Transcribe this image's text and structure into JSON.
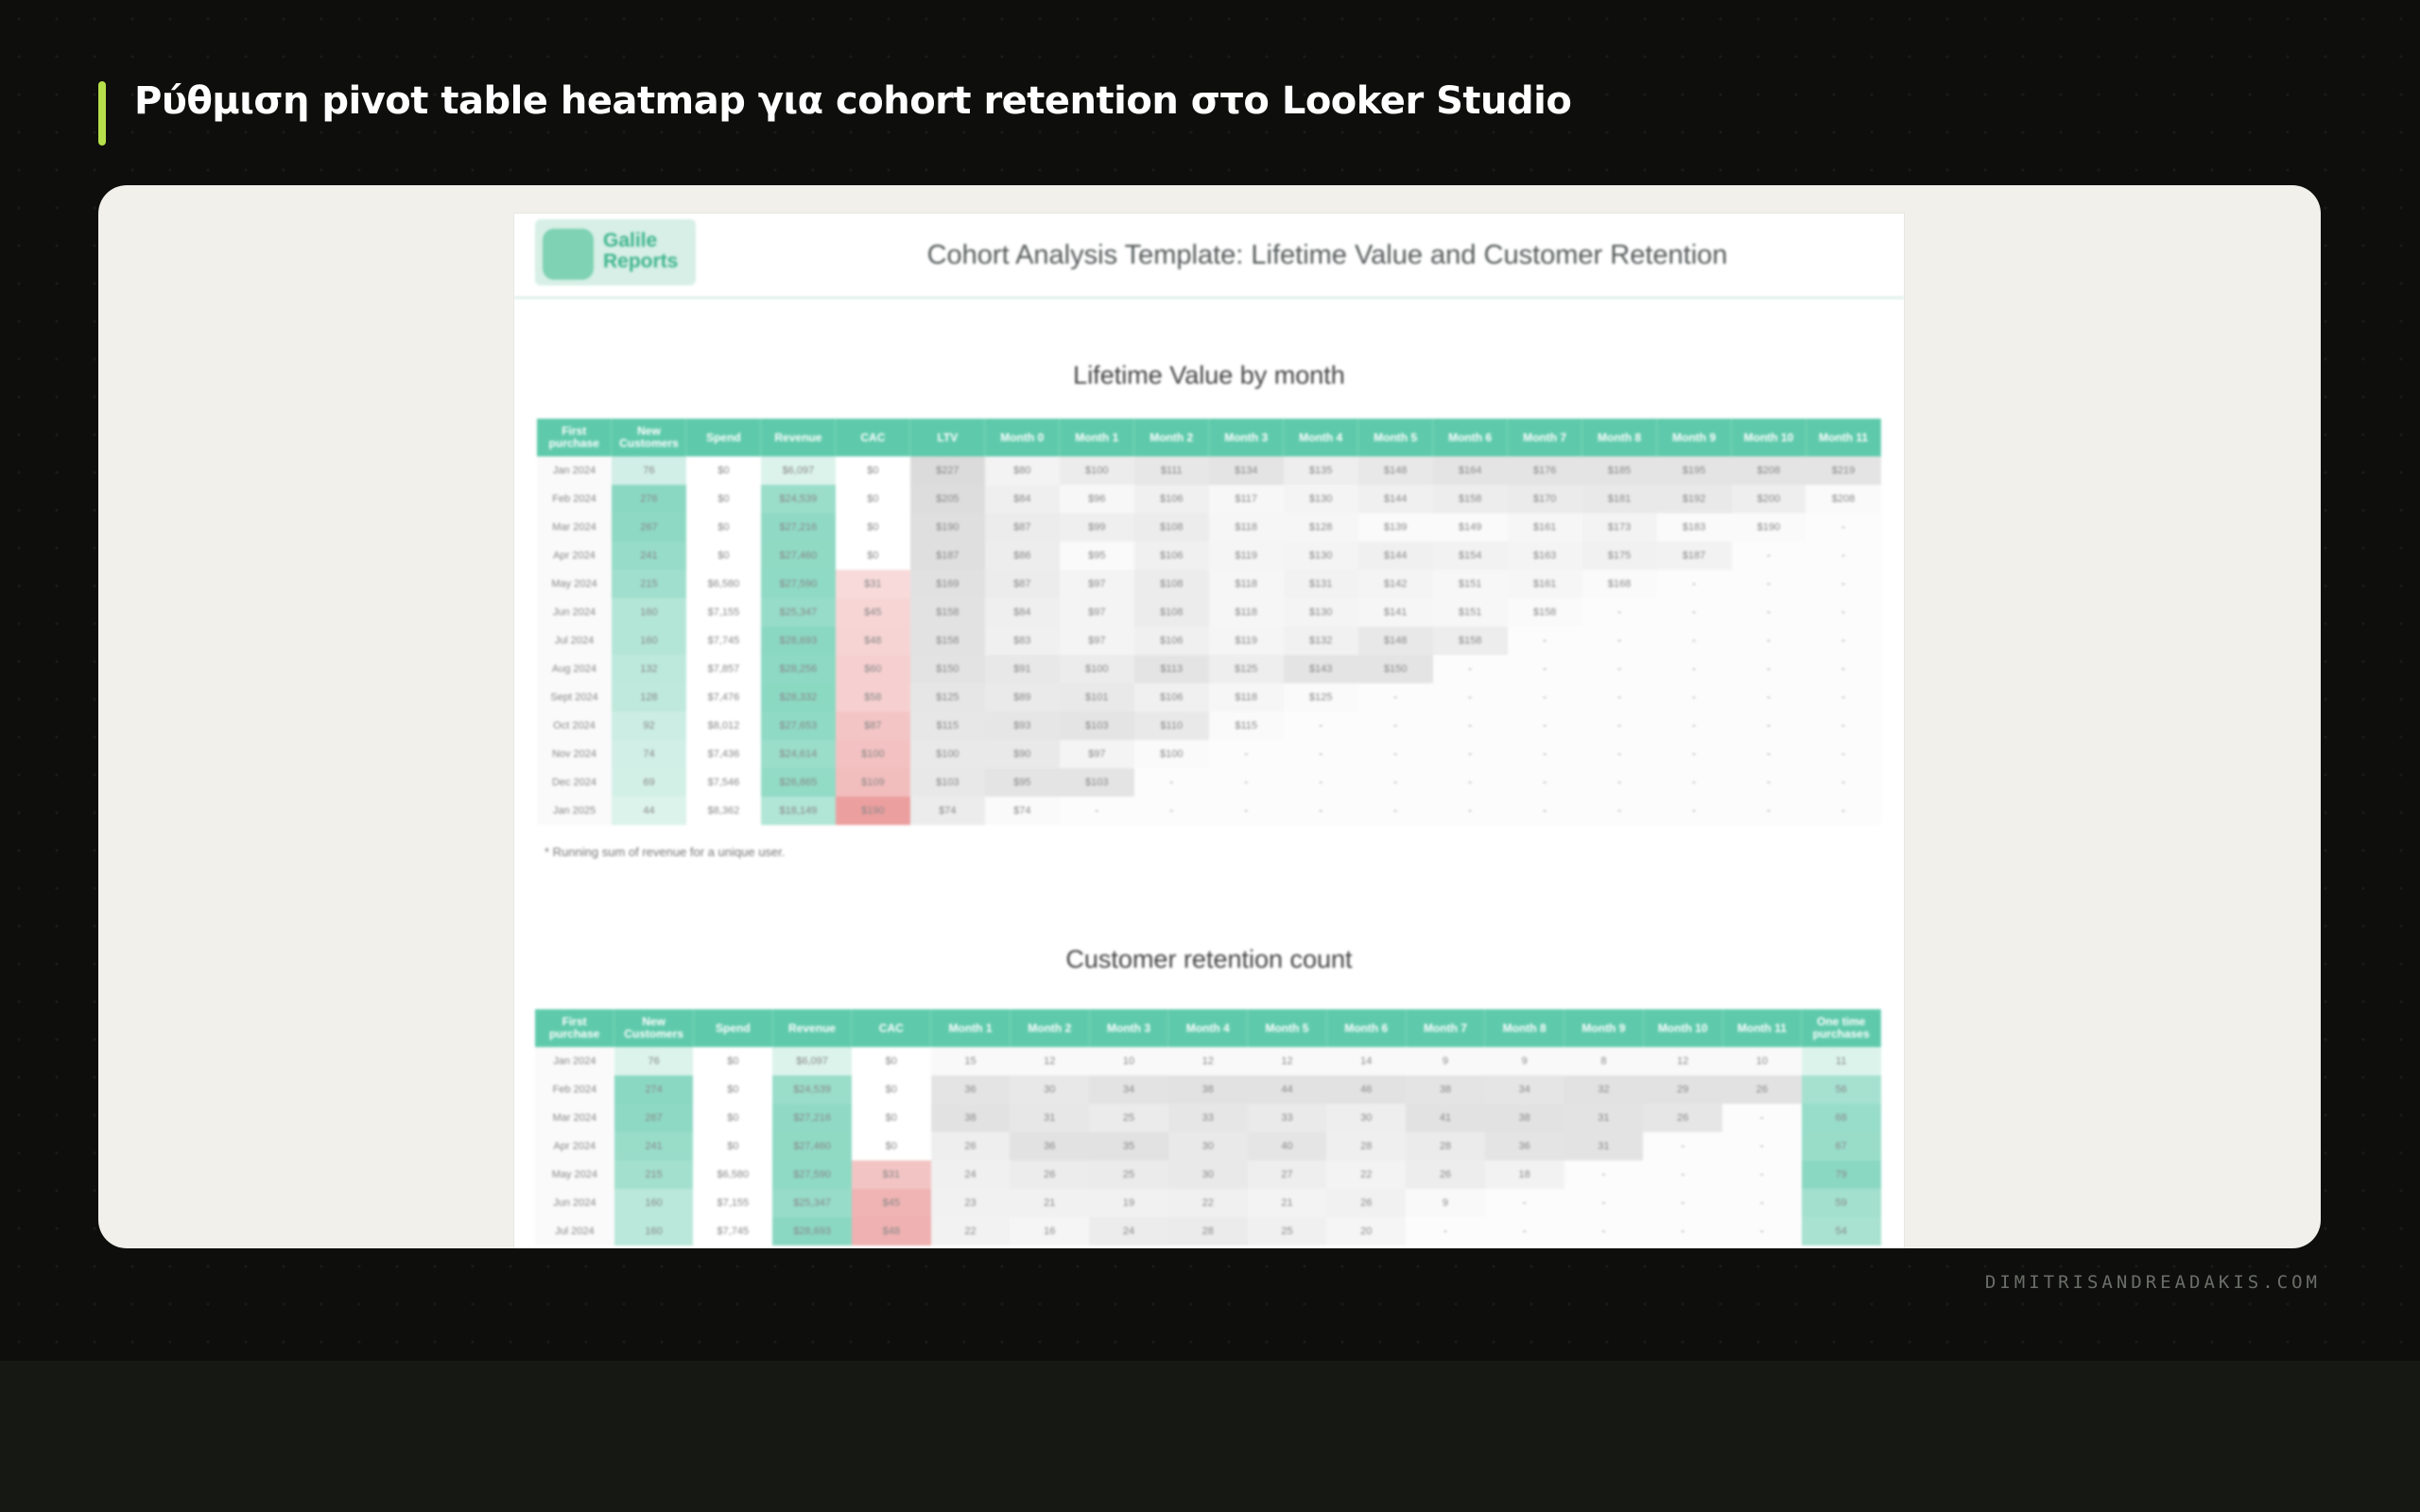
{
  "page": {
    "title": "Ρύθμιση pivot table heatmap για cohort retention στο Looker Studio",
    "credit": "DIMITRISANDREADAKIS.COM",
    "accent_color": "#b6e04a"
  },
  "document": {
    "logo_text": "Galile Reports",
    "title": "Cohort Analysis Template: Lifetime Value and Customer Retention",
    "brand_color": "#5fcaab"
  },
  "ltv_table": {
    "title": "Lifetime Value by month",
    "footnote": "* Running sum of revenue for a unique user.",
    "columns": [
      "First purchase",
      "New Customers",
      "Spend",
      "Revenue",
      "CAC",
      "LTV",
      "Month 0",
      "Month 1",
      "Month 2",
      "Month 3",
      "Month 4",
      "Month 5",
      "Month 6",
      "Month 7",
      "Month 8",
      "Month 9",
      "Month 10",
      "Month 11"
    ],
    "rows": [
      [
        "Jan 2024",
        "76",
        "$0",
        "$6,097",
        "$0",
        "$227",
        "$80",
        "$100",
        "$111",
        "$134",
        "$135",
        "$148",
        "$164",
        "$176",
        "$185",
        "$195",
        "$208",
        "$219"
      ],
      [
        "Feb 2024",
        "276",
        "$0",
        "$24,539",
        "$0",
        "$205",
        "$84",
        "$96",
        "$106",
        "$117",
        "$130",
        "$144",
        "$158",
        "$170",
        "$181",
        "$192",
        "$200",
        "$208"
      ],
      [
        "Mar 2024",
        "267",
        "$0",
        "$27,216",
        "$0",
        "$190",
        "$87",
        "$99",
        "$108",
        "$118",
        "$128",
        "$139",
        "$149",
        "$161",
        "$173",
        "$183",
        "$190",
        "-"
      ],
      [
        "Apr 2024",
        "241",
        "$0",
        "$27,460",
        "$0",
        "$187",
        "$86",
        "$95",
        "$106",
        "$119",
        "$130",
        "$144",
        "$154",
        "$163",
        "$175",
        "$187",
        "-",
        "-"
      ],
      [
        "May 2024",
        "215",
        "$6,580",
        "$27,590",
        "$31",
        "$169",
        "$87",
        "$97",
        "$108",
        "$118",
        "$131",
        "$142",
        "$151",
        "$161",
        "$168",
        "-",
        "-",
        "-"
      ],
      [
        "Jun 2024",
        "160",
        "$7,155",
        "$25,347",
        "$45",
        "$158",
        "$84",
        "$97",
        "$108",
        "$118",
        "$130",
        "$141",
        "$151",
        "$158",
        "-",
        "-",
        "-",
        "-"
      ],
      [
        "Jul 2024",
        "160",
        "$7,745",
        "$28,693",
        "$48",
        "$158",
        "$83",
        "$97",
        "$106",
        "$119",
        "$132",
        "$148",
        "$158",
        "-",
        "-",
        "-",
        "-",
        "-"
      ],
      [
        "Aug 2024",
        "132",
        "$7,857",
        "$28,256",
        "$60",
        "$150",
        "$91",
        "$100",
        "$113",
        "$125",
        "$143",
        "$150",
        "-",
        "-",
        "-",
        "-",
        "-",
        "-"
      ],
      [
        "Sept 2024",
        "128",
        "$7,476",
        "$28,332",
        "$58",
        "$125",
        "$89",
        "$101",
        "$106",
        "$118",
        "$125",
        "-",
        "-",
        "-",
        "-",
        "-",
        "-",
        "-"
      ],
      [
        "Oct 2024",
        "92",
        "$8,012",
        "$27,653",
        "$87",
        "$115",
        "$93",
        "$103",
        "$110",
        "$115",
        "-",
        "-",
        "-",
        "-",
        "-",
        "-",
        "-",
        "-"
      ],
      [
        "Nov 2024",
        "74",
        "$7,436",
        "$24,614",
        "$100",
        "$100",
        "$90",
        "$97",
        "$100",
        "-",
        "-",
        "-",
        "-",
        "-",
        "-",
        "-",
        "-",
        "-"
      ],
      [
        "Dec 2024",
        "69",
        "$7,546",
        "$26,865",
        "$109",
        "$103",
        "$95",
        "$103",
        "-",
        "-",
        "-",
        "-",
        "-",
        "-",
        "-",
        "-",
        "-",
        "-"
      ],
      [
        "Jan 2025",
        "44",
        "$8,362",
        "$18,149",
        "$190",
        "$74",
        "$74",
        "-",
        "-",
        "-",
        "-",
        "-",
        "-",
        "-",
        "-",
        "-",
        "-",
        "-"
      ]
    ]
  },
  "retention_table": {
    "title": "Customer retention count",
    "columns": [
      "First purchase",
      "New Customers",
      "Spend",
      "Revenue",
      "CAC",
      "Month 1",
      "Month 2",
      "Month 3",
      "Month 4",
      "Month 5",
      "Month 6",
      "Month 7",
      "Month 8",
      "Month 9",
      "Month 10",
      "Month 11",
      "One time purchases"
    ],
    "rows": [
      [
        "Jan 2024",
        "76",
        "$0",
        "$6,097",
        "$0",
        "15",
        "12",
        "10",
        "12",
        "12",
        "14",
        "9",
        "9",
        "8",
        "12",
        "10",
        "11"
      ],
      [
        "Feb 2024",
        "274",
        "$0",
        "$24,539",
        "$0",
        "36",
        "30",
        "34",
        "38",
        "44",
        "46",
        "38",
        "34",
        "32",
        "29",
        "26",
        "56"
      ],
      [
        "Mar 2024",
        "267",
        "$0",
        "$27,216",
        "$0",
        "38",
        "31",
        "25",
        "33",
        "33",
        "30",
        "41",
        "38",
        "31",
        "26",
        "-",
        "68"
      ],
      [
        "Apr 2024",
        "241",
        "$0",
        "$27,460",
        "$0",
        "26",
        "36",
        "35",
        "30",
        "40",
        "28",
        "28",
        "36",
        "31",
        "-",
        "-",
        "67"
      ],
      [
        "May 2024",
        "215",
        "$6,580",
        "$27,590",
        "$31",
        "24",
        "26",
        "25",
        "30",
        "27",
        "22",
        "26",
        "18",
        "-",
        "-",
        "-",
        "79"
      ],
      [
        "Jun 2024",
        "160",
        "$7,155",
        "$25,347",
        "$45",
        "23",
        "21",
        "19",
        "22",
        "21",
        "26",
        "9",
        "-",
        "-",
        "-",
        "-",
        "59"
      ],
      [
        "Jul 2024",
        "160",
        "$7,745",
        "$28,693",
        "$48",
        "22",
        "16",
        "24",
        "28",
        "25",
        "20",
        "-",
        "-",
        "-",
        "-",
        "-",
        "54"
      ]
    ]
  }
}
